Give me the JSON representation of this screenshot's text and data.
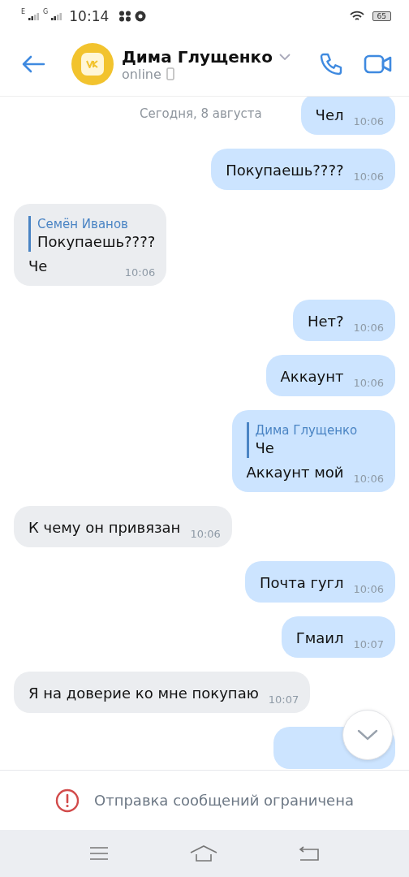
{
  "status_bar": {
    "network_1": "E",
    "network_2": "G",
    "time": "10:14",
    "battery": "65"
  },
  "header": {
    "name": "Дима Глущенко",
    "status": "online"
  },
  "date_separator": "Сегодня, 8 августа",
  "messages": [
    {
      "outgoing": true,
      "text": "Чел",
      "time": "10:06"
    },
    {
      "outgoing": true,
      "text": "Покупаешь????",
      "time": "10:06"
    },
    {
      "outgoing": false,
      "reply": {
        "author": "Семён Иванов",
        "text": "Покупаешь????"
      },
      "text": "Че",
      "time": "10:06"
    },
    {
      "outgoing": true,
      "text": "Нет?",
      "time": "10:06"
    },
    {
      "outgoing": true,
      "text": "Аккаунт",
      "time": "10:06"
    },
    {
      "outgoing": true,
      "reply": {
        "author": "Дима Глущенко",
        "text": "Че"
      },
      "text": "Аккаунт мой",
      "time": "10:06"
    },
    {
      "outgoing": false,
      "text": "К чему он привязан",
      "time": "10:06"
    },
    {
      "outgoing": true,
      "text": "Почта гугл",
      "time": "10:06"
    },
    {
      "outgoing": true,
      "text": "Гмаил",
      "time": "10:07"
    },
    {
      "outgoing": false,
      "text": "Я на доверие ко мне покупаю",
      "time": "10:07"
    },
    {
      "outgoing": true
    }
  ],
  "notice": "Отправка сообщений ограничена"
}
